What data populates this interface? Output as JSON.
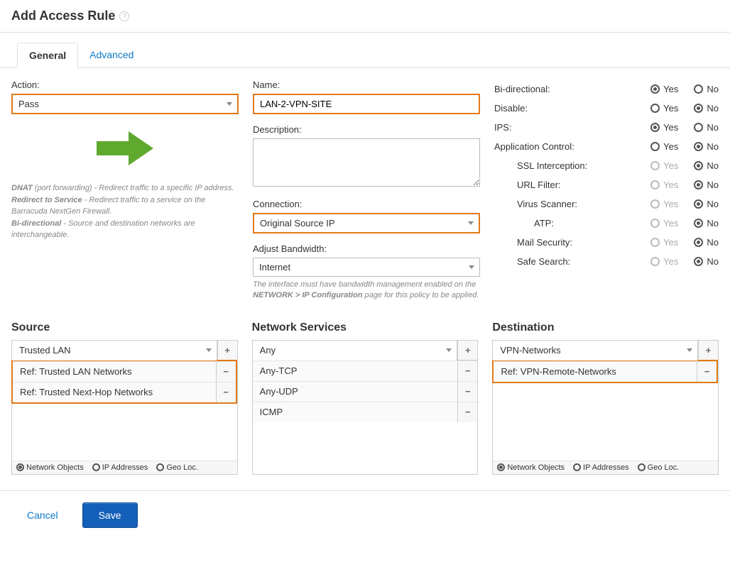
{
  "title": "Add Access Rule",
  "tabs": {
    "general": "General",
    "advanced": "Advanced"
  },
  "action": {
    "label": "Action:",
    "value": "Pass"
  },
  "hints": {
    "dnat_b": "DNAT",
    "dnat": " (port forwarding) - Redirect traffic to a specific IP address.",
    "redir_b": "Redirect to Service",
    "redir": " - Redirect traffic to a service on the Barracuda NextGen Firewall.",
    "bidir_b": "Bi-directional",
    "bidir": " - Source and destination networks are interchangeable."
  },
  "name": {
    "label": "Name:",
    "value": "LAN-2-VPN-SITE"
  },
  "description": {
    "label": "Description:",
    "value": ""
  },
  "connection": {
    "label": "Connection:",
    "value": "Original Source IP"
  },
  "bandwidth": {
    "label": "Adjust Bandwidth:",
    "value": "Internet",
    "note1": "The interface must have bandwidth management enabled on the ",
    "note_b": "NETWORK > IP Configuration",
    "note2": " page for this policy to be applied."
  },
  "opts": {
    "yes": "Yes",
    "no": "No"
  },
  "options": [
    {
      "label": "Bi-directional:",
      "val": "yes",
      "indent": 0,
      "disabled": false
    },
    {
      "label": "Disable:",
      "val": "no",
      "indent": 0,
      "disabled": false
    },
    {
      "label": "IPS:",
      "val": "yes",
      "indent": 0,
      "disabled": false
    },
    {
      "label": "Application Control:",
      "val": "no",
      "indent": 0,
      "disabled": false
    },
    {
      "label": "SSL Interception:",
      "val": "no",
      "indent": 1,
      "disabled": true
    },
    {
      "label": "URL Filter:",
      "val": "no",
      "indent": 1,
      "disabled": true
    },
    {
      "label": "Virus Scanner:",
      "val": "no",
      "indent": 1,
      "disabled": true
    },
    {
      "label": "ATP:",
      "val": "no",
      "indent": 2,
      "disabled": true
    },
    {
      "label": "Mail Security:",
      "val": "no",
      "indent": 1,
      "disabled": true
    },
    {
      "label": "Safe Search:",
      "val": "no",
      "indent": 1,
      "disabled": true
    }
  ],
  "source": {
    "title": "Source",
    "select": "Trusted LAN",
    "items": [
      "Ref: Trusted LAN Networks",
      "Ref: Trusted Next-Hop Networks"
    ],
    "seg": {
      "a": "Network Objects",
      "b": "IP Addresses",
      "c": "Geo Loc."
    }
  },
  "services": {
    "title": "Network Services",
    "select": "Any",
    "items": [
      "Any-TCP",
      "Any-UDP",
      "ICMP"
    ]
  },
  "destination": {
    "title": "Destination",
    "select": "VPN-Networks",
    "items": [
      "Ref: VPN-Remote-Networks"
    ],
    "seg": {
      "a": "Network Objects",
      "b": "IP Addresses",
      "c": "Geo Loc."
    }
  },
  "buttons": {
    "cancel": "Cancel",
    "save": "Save"
  }
}
